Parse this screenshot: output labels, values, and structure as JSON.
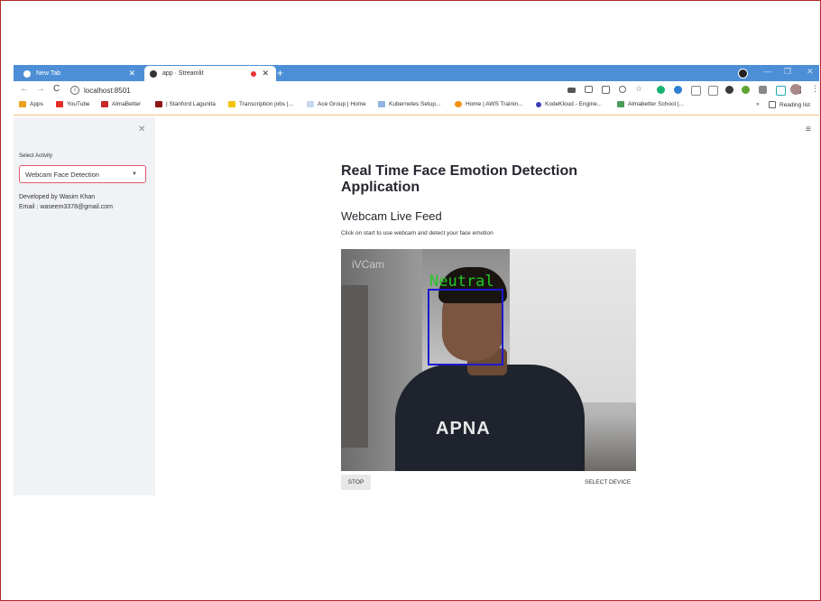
{
  "browser": {
    "tabs": [
      {
        "label": "New Tab",
        "active": false
      },
      {
        "label": "app · Streamlit",
        "active": true,
        "recording": true
      }
    ],
    "new_tab_symbol": "+",
    "url": "localhost:8501",
    "window_controls": [
      "—",
      "❐",
      "✕"
    ]
  },
  "bookmarks": {
    "apps": "Apps",
    "items": [
      "YouTube",
      "AlmaBetter",
      "| Stanford Lagunita",
      "Transcription jobs |...",
      "Ace Group | Home",
      "Kubernetes Setup...",
      "Home | AWS Trainin...",
      "KodeKloud - Engine...",
      "Almabetter School |..."
    ],
    "more": "»",
    "reading_list": "Reading list"
  },
  "sidebar": {
    "select_label": "Select Activity",
    "selected_value": "Webcam Face Detection",
    "developer": "Developed by Wasim Khan",
    "email": "Email : waseem3378@gmail.com"
  },
  "main": {
    "title": "Real Time Face Emotion Detection Application",
    "subheader": "Webcam Live Feed",
    "caption": "Click on start to use webcam and detect your face emotion",
    "video": {
      "watermark": "iVCam",
      "detected_emotion": "Neutral",
      "shirt_print": "APNA"
    },
    "stop_button": "STOP",
    "select_device": "SELECT DEVICE"
  },
  "colors": {
    "tab_bar": "#4d8fd6",
    "sidebar_bg": "#f0f2f6",
    "select_border": "#e05a6b",
    "emotion_text": "#22c722",
    "face_box": "#1a1ad0"
  }
}
